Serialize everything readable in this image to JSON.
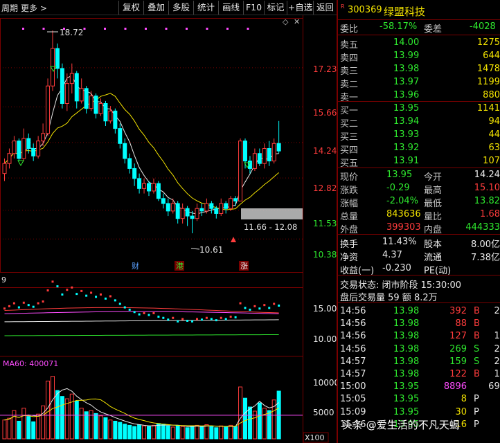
{
  "toolbar": {
    "left_label": "周期",
    "more_label": "更多 >",
    "buttons": [
      "复权",
      "叠加",
      "多股",
      "统计",
      "画线",
      "F10",
      "标记",
      "+自选",
      "返回"
    ]
  },
  "chart": {
    "price_labels": [
      "17.23",
      "15.66",
      "14.24",
      "12.82",
      "11.53",
      "10.38"
    ],
    "high_label": "18.72",
    "low_label": "10.61",
    "range_label": "11.66 - 12.08",
    "event_badges": [
      "财",
      "港",
      "涨"
    ],
    "vol_axis_labels": [
      "15.00",
      "10.00"
    ],
    "vol_header": "9",
    "ma_header": "MA60: 400071",
    "macd_axis_labels": [
      "10000",
      "5000"
    ],
    "x100": "X100"
  },
  "quote": {
    "r_badge": "R",
    "code": "300369",
    "name": "绿盟科技",
    "weibi_label": "委比",
    "weibi_value": "-58.17%",
    "weicha_label": "委差",
    "weicha_value": "-4028",
    "sells": [
      {
        "label": "卖五",
        "price": "14.00",
        "vol": "1275"
      },
      {
        "label": "卖四",
        "price": "13.99",
        "vol": "644"
      },
      {
        "label": "卖三",
        "price": "13.98",
        "vol": "1478"
      },
      {
        "label": "卖二",
        "price": "13.97",
        "vol": "1199"
      },
      {
        "label": "卖一",
        "price": "13.96",
        "vol": "880"
      }
    ],
    "buys": [
      {
        "label": "买一",
        "price": "13.95",
        "vol": "1141"
      },
      {
        "label": "买二",
        "price": "13.94",
        "vol": "94"
      },
      {
        "label": "买三",
        "price": "13.93",
        "vol": "44"
      },
      {
        "label": "买四",
        "price": "13.92",
        "vol": "63"
      },
      {
        "label": "买五",
        "price": "13.91",
        "vol": "107"
      }
    ],
    "stats": [
      {
        "l1": "现价",
        "v1": "13.95",
        "c1": "green",
        "l2": "今开",
        "v2": "14.24",
        "c2": "white"
      },
      {
        "l1": "涨跌",
        "v1": "-0.29",
        "c1": "green",
        "l2": "最高",
        "v2": "15.10",
        "c2": "red"
      },
      {
        "l1": "涨幅",
        "v1": "-2.04%",
        "c1": "green",
        "l2": "最低",
        "v2": "13.82",
        "c2": "green"
      },
      {
        "l1": "总量",
        "v1": "843636",
        "c1": "yellow",
        "l2": "量比",
        "v2": "1.68",
        "c2": "red"
      },
      {
        "l1": "外盘",
        "v1": "399303",
        "c1": "red",
        "l2": "内盘",
        "v2": "444333",
        "c2": "green"
      }
    ],
    "stats2": [
      {
        "l1": "换手",
        "v1": "11.43%",
        "l2": "股本",
        "v2": "8.00亿"
      },
      {
        "l1": "净资",
        "v1": "4.37",
        "l2": "流通",
        "v2": "7.38亿"
      },
      {
        "l1": "收益(一)",
        "v1": "-0.230",
        "l2": "PE(动)",
        "v2": ""
      }
    ],
    "trade_status": "交易状态: 闭市阶段 15:30:00",
    "after_hours": "盘后交易量 59 额 8.2万",
    "ticks": [
      {
        "time": "14:56",
        "price": "13.98",
        "vol": "392",
        "bs": "B",
        "n": "21"
      },
      {
        "time": "14:56",
        "price": "13.98",
        "vol": "88",
        "bs": "B",
        "n": "5"
      },
      {
        "time": "14:56",
        "price": "13.98",
        "vol": "127",
        "bs": "B",
        "n": "11"
      },
      {
        "time": "14:56",
        "price": "13.98",
        "vol": "269",
        "bs": "S",
        "n": "21"
      },
      {
        "time": "14:57",
        "price": "13.98",
        "vol": "159",
        "bs": "S",
        "n": "21"
      },
      {
        "time": "14:57",
        "price": "13.98",
        "vol": "122",
        "bs": "B",
        "n": "11"
      },
      {
        "time": "15:00",
        "price": "13.95",
        "vol": "8896",
        "bs": "",
        "n": "694"
      },
      {
        "time": "15:05",
        "price": "13.95",
        "vol": "8",
        "bs": "P",
        "n": "2"
      },
      {
        "time": "15:09",
        "price": "13.95",
        "vol": "30",
        "bs": "P",
        "n": "5"
      },
      {
        "time": "15:16",
        "price": "13.95",
        "vol": "16",
        "bs": "P",
        "n": "1"
      }
    ]
  },
  "watermark": "头条 @爱生活的不凡天蝎",
  "colors": {
    "up": "#ff3c3c",
    "down": "#00ffff",
    "ma_yellow": "#f2e200",
    "ma_white": "#e8e8e8",
    "border": "#7a0000"
  }
}
